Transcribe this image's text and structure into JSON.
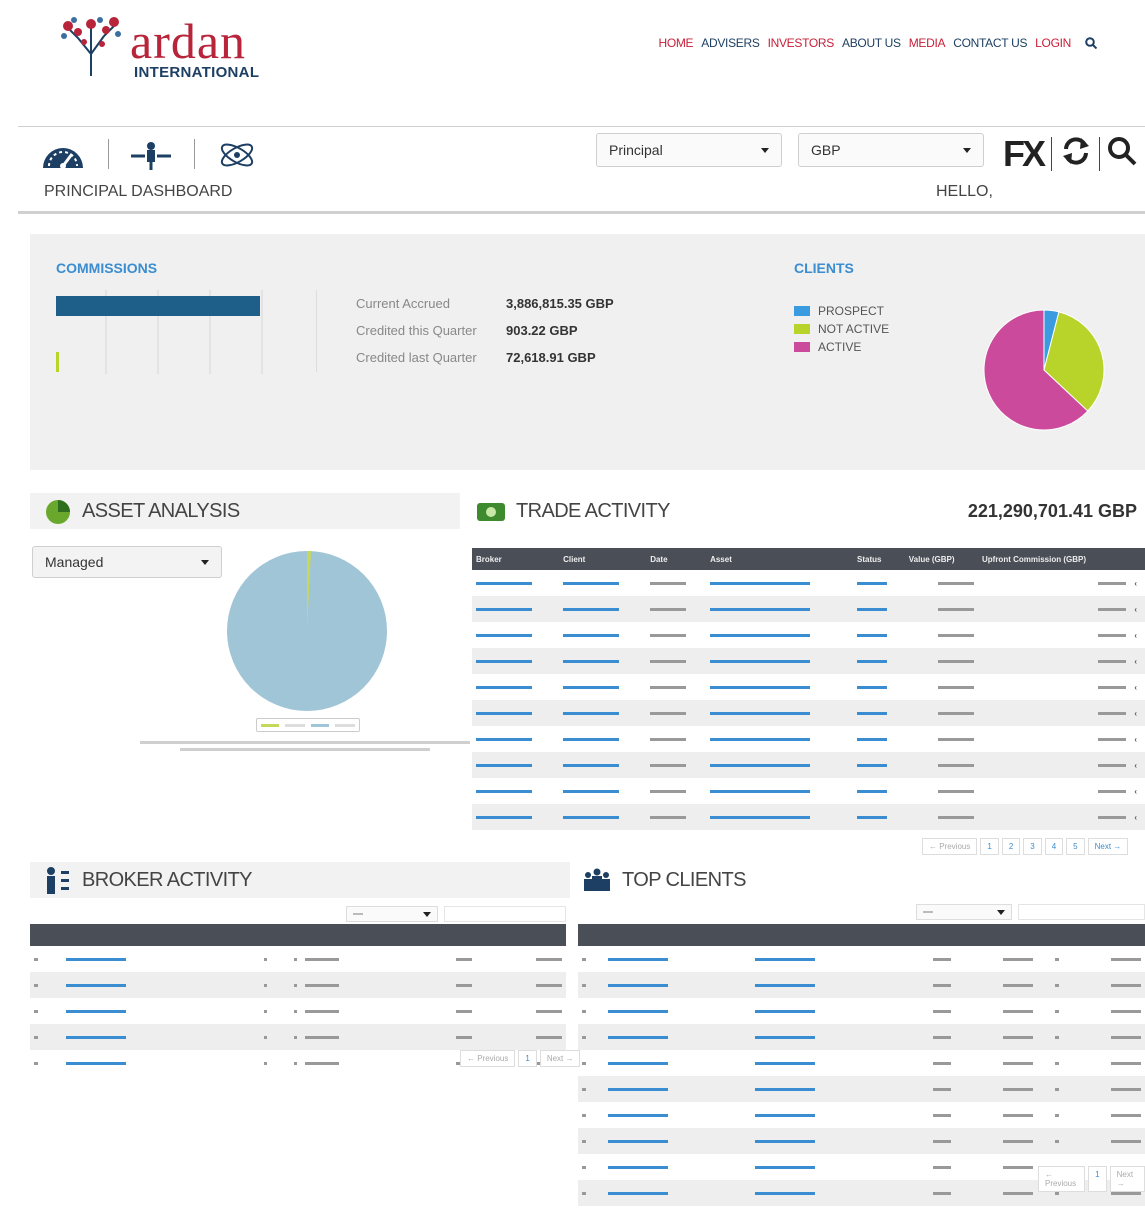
{
  "header": {
    "logo_text": "ardan",
    "logo_sub": "INTERNATIONAL",
    "nav": [
      {
        "label": "HOME",
        "color": "red"
      },
      {
        "label": "ADVISERS",
        "color": "blue"
      },
      {
        "label": "INVESTORS",
        "color": "red"
      },
      {
        "label": "ABOUT US",
        "color": "blue"
      },
      {
        "label": "MEDIA",
        "color": "red"
      },
      {
        "label": "CONTACT US",
        "color": "blue"
      },
      {
        "label": "LOGIN",
        "color": "red"
      }
    ]
  },
  "toolbar": {
    "role_select": "Principal",
    "currency_select": "GBP",
    "fx_label": "FX",
    "page_title": "PRINCIPAL DASHBOARD",
    "greeting": "HELLO,"
  },
  "commissions": {
    "title": "COMMISSIONS",
    "rows": [
      {
        "label": "Current Accrued",
        "value": "3,886,815.35 GBP"
      },
      {
        "label": "Credited this Quarter",
        "value": "903.22 GBP"
      },
      {
        "label": "Credited last Quarter",
        "value": "72,618.91 GBP"
      }
    ]
  },
  "clients": {
    "title": "CLIENTS",
    "legend": [
      {
        "label": "PROSPECT",
        "color": "#3a9be0",
        "value": 4
      },
      {
        "label": "NOT ACTIVE",
        "color": "#b8d42a",
        "value": 33
      },
      {
        "label": "ACTIVE",
        "color": "#cc4a9c",
        "value": 63
      }
    ]
  },
  "asset_analysis": {
    "title": "ASSET ANALYSIS",
    "select": "Managed",
    "pie_color": "#a0c5d6",
    "slice_color": "#c6d85a"
  },
  "trade_activity": {
    "title": "TRADE ACTIVITY",
    "total": "221,290,701.41 GBP",
    "columns": [
      "Broker",
      "Client",
      "Date",
      "Asset",
      "Status",
      "Value (GBP)",
      "Upfront Commission (GBP)"
    ],
    "pager": {
      "prev": "← Previous",
      "pages": [
        "1",
        "2",
        "3",
        "4",
        "5"
      ],
      "next": "Next →"
    }
  },
  "broker_activity": {
    "title": "BROKER ACTIVITY",
    "pager": {
      "prev": "← Previous",
      "pages": [
        "1"
      ],
      "next": "Next →"
    }
  },
  "top_clients": {
    "title": "TOP CLIENTS",
    "pager": {
      "prev": "← Previous",
      "pages": [
        "1"
      ],
      "next": "Next →"
    }
  }
}
